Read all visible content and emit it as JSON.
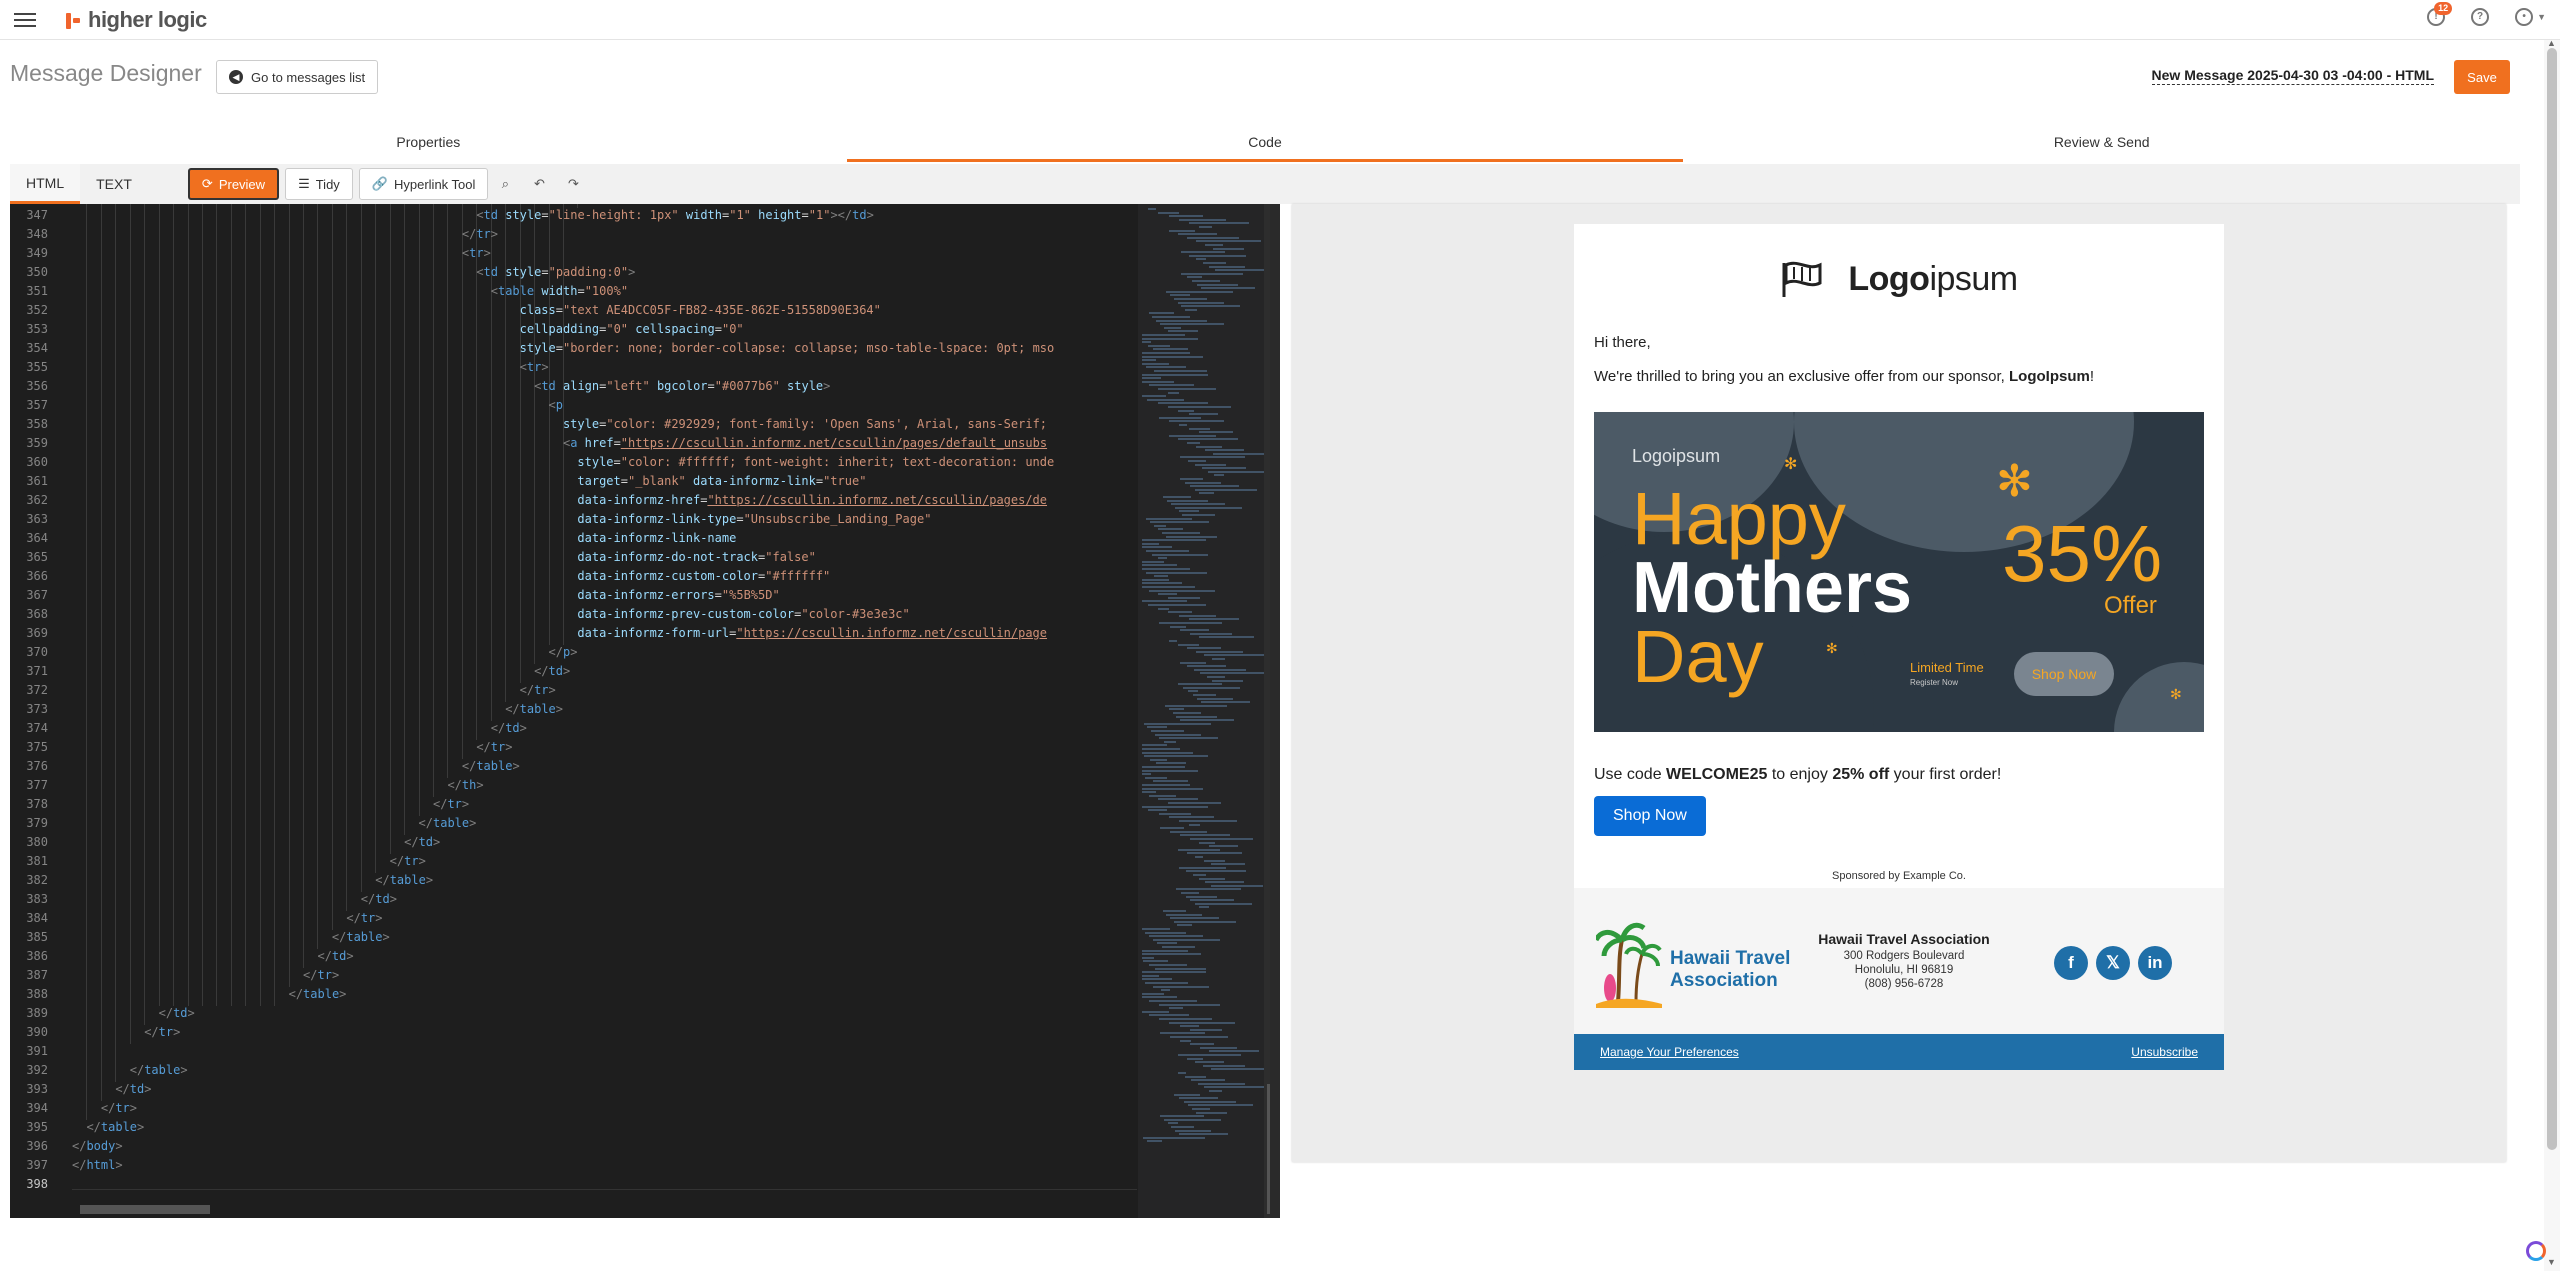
{
  "app": {
    "brand": "higher logic",
    "notifications": "12"
  },
  "header": {
    "title": "Message Designer",
    "back_label": "Go to messages list",
    "message_name": "New Message 2025-04-30 03 -04:00 - HTML",
    "save_label": "Save"
  },
  "steps": [
    {
      "label": "Properties"
    },
    {
      "label": "Code"
    },
    {
      "label": "Review & Send"
    }
  ],
  "toolbar": {
    "tabs": [
      "HTML",
      "TEXT"
    ],
    "preview_label": "Preview",
    "tidy_label": "Tidy",
    "hyperlink_label": "Hyperlink Tool"
  },
  "editor": {
    "line_start": 347,
    "lines": [
      {
        "i": 28,
        "t": "<td style=\"line-height: 1px\" width=\"1\" height=\"1\"></td>"
      },
      {
        "i": 27,
        "t": "</tr>"
      },
      {
        "i": 27,
        "t": "<tr>"
      },
      {
        "i": 28,
        "t": "<td style=\"padding:0\">"
      },
      {
        "i": 29,
        "t": "<table width=\"100%\""
      },
      {
        "i": 31,
        "t": "class=\"text AE4DCC05F-FB82-435E-862E-51558D90E364\""
      },
      {
        "i": 31,
        "t": "cellpadding=\"0\" cellspacing=\"0\""
      },
      {
        "i": 31,
        "t": "style=\"border: none; border-collapse: collapse; mso-table-lspace: 0pt; mso"
      },
      {
        "i": 31,
        "t": "<tr>"
      },
      {
        "i": 32,
        "t": "<td align=\"left\" bgcolor=\"#0077b6\" style>"
      },
      {
        "i": 33,
        "t": "<p"
      },
      {
        "i": 34,
        "t": "style=\"color: #292929; font-family: 'Open Sans', Arial, sans-Serif;"
      },
      {
        "i": 34,
        "t": "<a href=\"https://cscullin.informz.net/cscullin/pages/default_unsubs"
      },
      {
        "i": 35,
        "t": "style=\"color: #ffffff; font-weight: inherit; text-decoration: unde"
      },
      {
        "i": 35,
        "t": "target=\"_blank\" data-informz-link=\"true\""
      },
      {
        "i": 35,
        "t": "data-informz-href=\"https://cscullin.informz.net/cscullin/pages/de"
      },
      {
        "i": 35,
        "t": "data-informz-link-type=\"Unsubscribe_Landing_Page\""
      },
      {
        "i": 35,
        "t": "data-informz-link-name"
      },
      {
        "i": 35,
        "t": "data-informz-do-not-track=\"false\""
      },
      {
        "i": 35,
        "t": "data-informz-custom-color=\"#ffffff\""
      },
      {
        "i": 35,
        "t": "data-informz-errors=\"%5B%5D\""
      },
      {
        "i": 35,
        "t": "data-informz-prev-custom-color=\"color-#3e3e3c\""
      },
      {
        "i": 35,
        "t": "data-informz-form-url=\"https://cscullin.informz.net/cscullin/page"
      },
      {
        "i": 33,
        "t": "</p>"
      },
      {
        "i": 32,
        "t": "</td>"
      },
      {
        "i": 31,
        "t": "</tr>"
      },
      {
        "i": 30,
        "t": "</table>"
      },
      {
        "i": 29,
        "t": "</td>"
      },
      {
        "i": 28,
        "t": "</tr>"
      },
      {
        "i": 27,
        "t": "</table>"
      },
      {
        "i": 26,
        "t": "</th>"
      },
      {
        "i": 25,
        "t": "</tr>"
      },
      {
        "i": 24,
        "t": "</table>"
      },
      {
        "i": 23,
        "t": "</td>"
      },
      {
        "i": 22,
        "t": "</tr>"
      },
      {
        "i": 21,
        "t": "</table>"
      },
      {
        "i": 20,
        "t": "</td>"
      },
      {
        "i": 19,
        "t": "</tr>"
      },
      {
        "i": 18,
        "t": "</table>"
      },
      {
        "i": 17,
        "t": "</td>"
      },
      {
        "i": 16,
        "t": "</tr>"
      },
      {
        "i": 15,
        "t": "</table>"
      },
      {
        "i": 6,
        "t": "</td>"
      },
      {
        "i": 5,
        "t": "</tr>"
      },
      {
        "i": 0,
        "t": ""
      },
      {
        "i": 4,
        "t": "</table>"
      },
      {
        "i": 3,
        "t": "</td>"
      },
      {
        "i": 2,
        "t": "</tr>"
      },
      {
        "i": 1,
        "t": "</table>"
      },
      {
        "i": 0,
        "t": "</body>"
      },
      {
        "i": 0,
        "t": "</html>"
      },
      {
        "i": 0,
        "t": ""
      }
    ]
  },
  "email": {
    "logo_bold": "Logo",
    "logo_light": "ipsum",
    "greeting": "Hi there,",
    "intro_pre": "We're thrilled to bring you an exclusive offer from our sponsor, ",
    "intro_sponsor": "LogoIpsum",
    "intro_post": "!",
    "banner": {
      "logo": "Logoipsum",
      "happy": "Happy",
      "mothers": "Mothers",
      "day": "Day",
      "percent": "35%",
      "offer": "Offer",
      "limited": "Limited Time",
      "register": "Register Now",
      "shop": "Shop Now"
    },
    "code_pre": "Use code ",
    "code": "WELCOME25",
    "code_mid": " to enjoy ",
    "discount": "25% off",
    "code_post": " your first order!",
    "shop_button": "Shop Now",
    "sponsor_line": "Sponsored by Example Co.",
    "footer": {
      "logo_line1": "Hawaii Travel",
      "logo_line2": "Association",
      "org": "Hawaii Travel Association",
      "address1": "300 Rodgers Boulevard",
      "address2": "Honolulu, HI 96819",
      "phone": "(808) 956-6728"
    },
    "manage_link": "Manage Your Preferences",
    "unsubscribe_link": "Unsubscribe"
  },
  "colors": {
    "accent": "#f0701f",
    "editor_bg": "#1e1e1e",
    "footer_blue": "#1f6fa8",
    "banner_bg": "#2c3843",
    "banner_gold": "#f5a623"
  }
}
